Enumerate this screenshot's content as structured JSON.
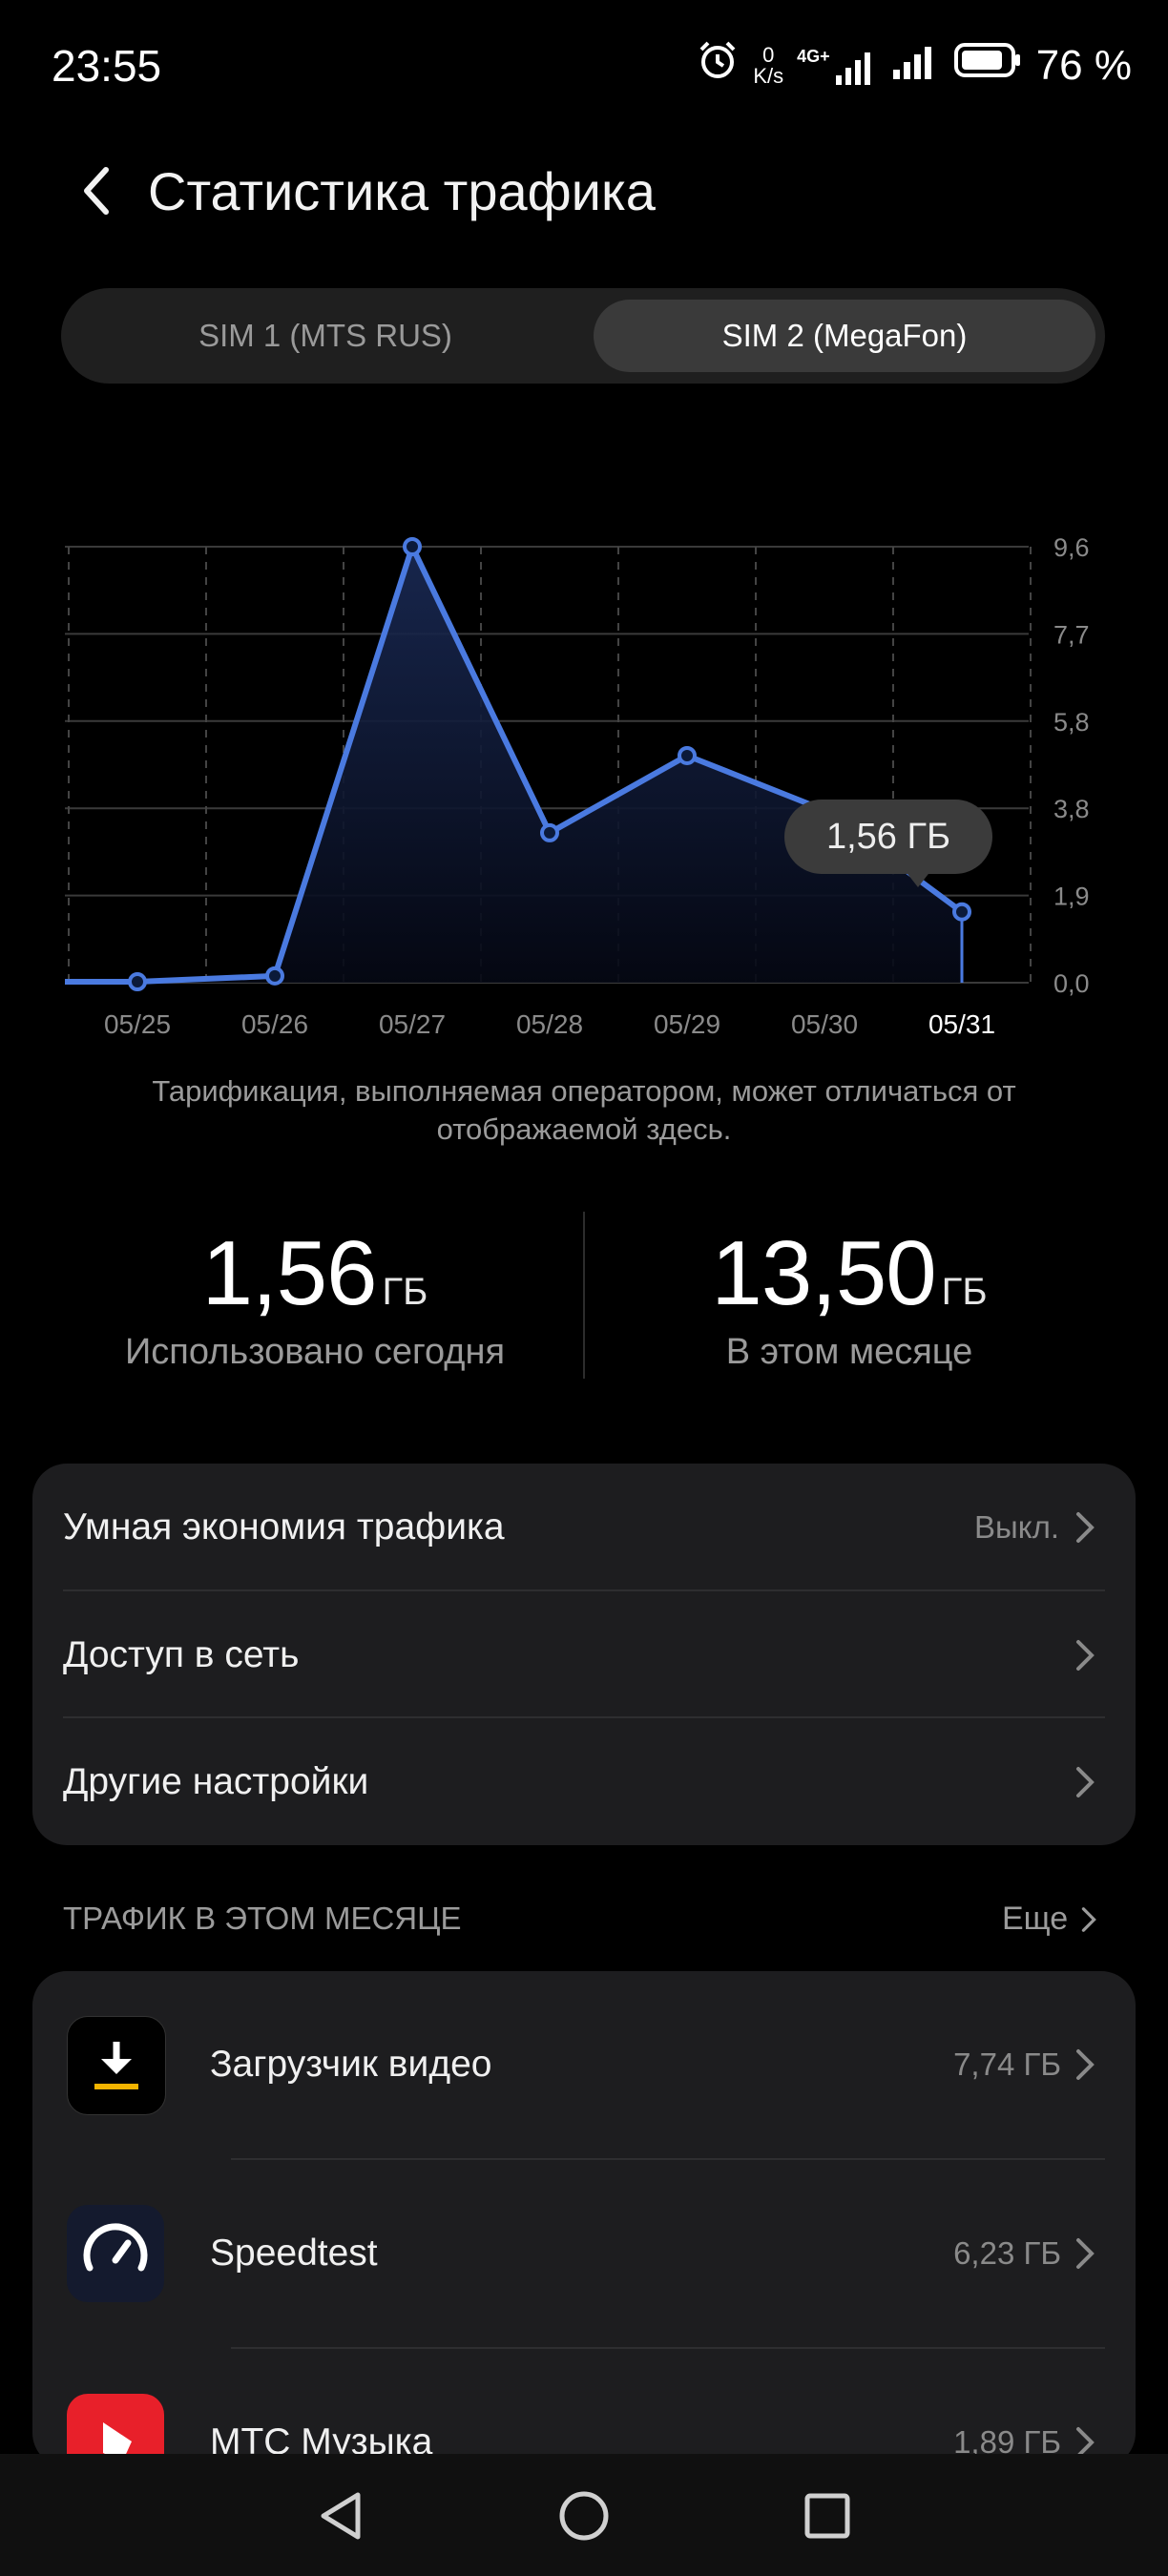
{
  "status_bar": {
    "time": "23:55",
    "net_speed_value": "0",
    "net_speed_unit": "K/s",
    "network_type": "4G+",
    "battery_percent": "76 %",
    "icons": [
      "alarm-icon",
      "signal-4g-icon",
      "signal-icon",
      "battery-icon"
    ]
  },
  "header": {
    "title": "Статистика трафика",
    "back_icon": "chevron-left-icon"
  },
  "sim_tabs": [
    {
      "label": "SIM 1 (MTS RUS)",
      "selected": false
    },
    {
      "label": "SIM 2 (MegaFon)",
      "selected": true
    }
  ],
  "chart_data": {
    "type": "area",
    "title": "",
    "xlabel": "",
    "ylabel": "",
    "categories": [
      "05/25",
      "05/26",
      "05/27",
      "05/28",
      "05/29",
      "05/30",
      "05/31"
    ],
    "values": [
      0.02,
      0.15,
      9.6,
      3.3,
      5.0,
      3.8,
      1.56
    ],
    "y_ticks": [
      "9,6",
      "7,7",
      "5,8",
      "3,8",
      "1,9",
      "0,0"
    ],
    "ylim": [
      0,
      9.6
    ],
    "grid": true,
    "selected_category": "05/31",
    "tooltip": "1,56 ГБ",
    "line_color": "#4a7ae0"
  },
  "note": "Тарификация, выполняемая оператором, может отличаться от отображаемой здесь.",
  "totals": {
    "today": {
      "value": "1,56",
      "unit": "ГБ",
      "caption": "Использовано сегодня"
    },
    "month": {
      "value": "13,50",
      "unit": "ГБ",
      "caption": "В этом месяце"
    }
  },
  "settings": [
    {
      "label": "Умная экономия трафика",
      "value": "Выкл."
    },
    {
      "label": "Доступ в сеть",
      "value": ""
    },
    {
      "label": "Другие настройки",
      "value": ""
    }
  ],
  "section": {
    "label": "ТРАФИК В ЭТОМ МЕСЯЦЕ",
    "more": "Еще"
  },
  "apps": [
    {
      "name": "Загрузчик видео",
      "usage": "7,74 ГБ",
      "icon": "download-icon"
    },
    {
      "name": "Speedtest",
      "usage": "6,23 ГБ",
      "icon": "speedometer-icon"
    },
    {
      "name": "МТС Музыка",
      "usage": "1,89 ГБ",
      "icon": "mts-music-icon"
    }
  ],
  "nav": [
    "back-nav-icon",
    "home-nav-icon",
    "recents-nav-icon"
  ]
}
